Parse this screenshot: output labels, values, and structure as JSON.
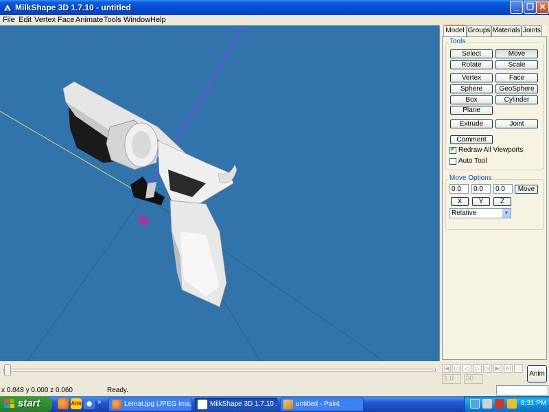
{
  "window": {
    "title": "MilkShape 3D 1.7.10 - untitled",
    "minimize_glyph": "_",
    "maximize_glyph": "❐",
    "close_glyph": "✕"
  },
  "menu": [
    "File",
    "Edit",
    "Vertex",
    "Face",
    "Animate",
    "Tools",
    "Window",
    "Help"
  ],
  "panel": {
    "tabs": [
      "Model",
      "Groups",
      "Materials",
      "Joints"
    ],
    "active_tab": "Model",
    "tools_label": "Tools",
    "buttons": {
      "select": "Select",
      "move": "Move",
      "rotate": "Rotate",
      "scale": "Scale",
      "vertex": "Vertex",
      "face": "Face",
      "sphere": "Sphere",
      "geosphere": "GeoSphere",
      "box": "Box",
      "cylinder": "Cylinder",
      "plane": "Plane",
      "extrude": "Extrude",
      "joint": "Joint",
      "comment": "Comment"
    },
    "active_tool": "Move",
    "redraw_all_viewports": {
      "label": "Redraw All Viewports",
      "checked": true
    },
    "auto_tool": {
      "label": "Auto Tool",
      "checked": false
    },
    "move_options": {
      "label": "Move Options",
      "x": "0.0",
      "y": "0.0",
      "z": "0.0",
      "move_button": "Move",
      "axis_x": "X",
      "axis_y": "Y",
      "axis_z": "Z",
      "mode": "Relative"
    }
  },
  "timeline": {
    "start_frame": "1.0",
    "end_frame": "30",
    "anim_button": "Anim",
    "nav_glyphs": [
      "|◀",
      "|◁",
      "◁",
      "▷",
      "▷|",
      "▶|",
      "⊳|"
    ]
  },
  "status": {
    "coords": "x 0.048 y 0.000 z 0.060",
    "message": "Ready."
  },
  "taskbar": {
    "start": "start",
    "overflow": "»",
    "tasks": [
      {
        "label": "Lemat.jpg (JPEG Ima...",
        "active": false
      },
      {
        "label": "MilkShape 3D 1.7.10 ...",
        "active": true
      },
      {
        "label": "untitled - Paint",
        "active": false
      }
    ],
    "clock": "8:31 PM"
  },
  "colors": {
    "viewport_bg": "#3174ab",
    "model_light": "#e8e8e8",
    "model_dark": "#1a1a1a",
    "axis_purple": "#8040ff",
    "axis_yellow": "#d8e060"
  },
  "icons": {
    "app": "milkshape-app-icon",
    "quick_launch": [
      "firefox-icon",
      "aim-icon",
      "chat-icon"
    ],
    "tray": [
      "network-icon",
      "volume-icon",
      "security-icon",
      "update-icon"
    ]
  }
}
